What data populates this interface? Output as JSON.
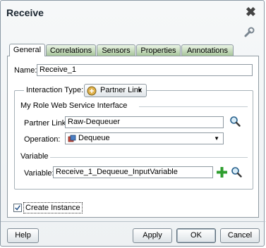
{
  "dialog": {
    "title": "Receive"
  },
  "tabs": [
    {
      "label": "General",
      "active": true
    },
    {
      "label": "Correlations",
      "active": false
    },
    {
      "label": "Sensors",
      "active": false
    },
    {
      "label": "Properties",
      "active": false
    },
    {
      "label": "Annotations",
      "active": false
    }
  ],
  "name": {
    "label": "Name:",
    "value": "Receive_1"
  },
  "interaction": {
    "label": "Interaction Type:",
    "selected": "Partner Link"
  },
  "role_section": {
    "title": "My Role Web Service Interface"
  },
  "partner_link": {
    "label": "Partner Link:",
    "value": "Raw-Dequeuer"
  },
  "operation": {
    "label": "Operation:",
    "selected": "Dequeue"
  },
  "variable_section": {
    "title": "Variable"
  },
  "variable": {
    "label": "Variable:",
    "value": "Receive_1_Dequeue_InputVariable"
  },
  "create_instance": {
    "label": "Create Instance",
    "checked": true
  },
  "buttons": {
    "help": "Help",
    "apply": "Apply",
    "ok": "OK",
    "cancel": "Cancel"
  },
  "colors": {
    "tab_green": "#a8c59b",
    "add_green": "#2f9e2f"
  }
}
